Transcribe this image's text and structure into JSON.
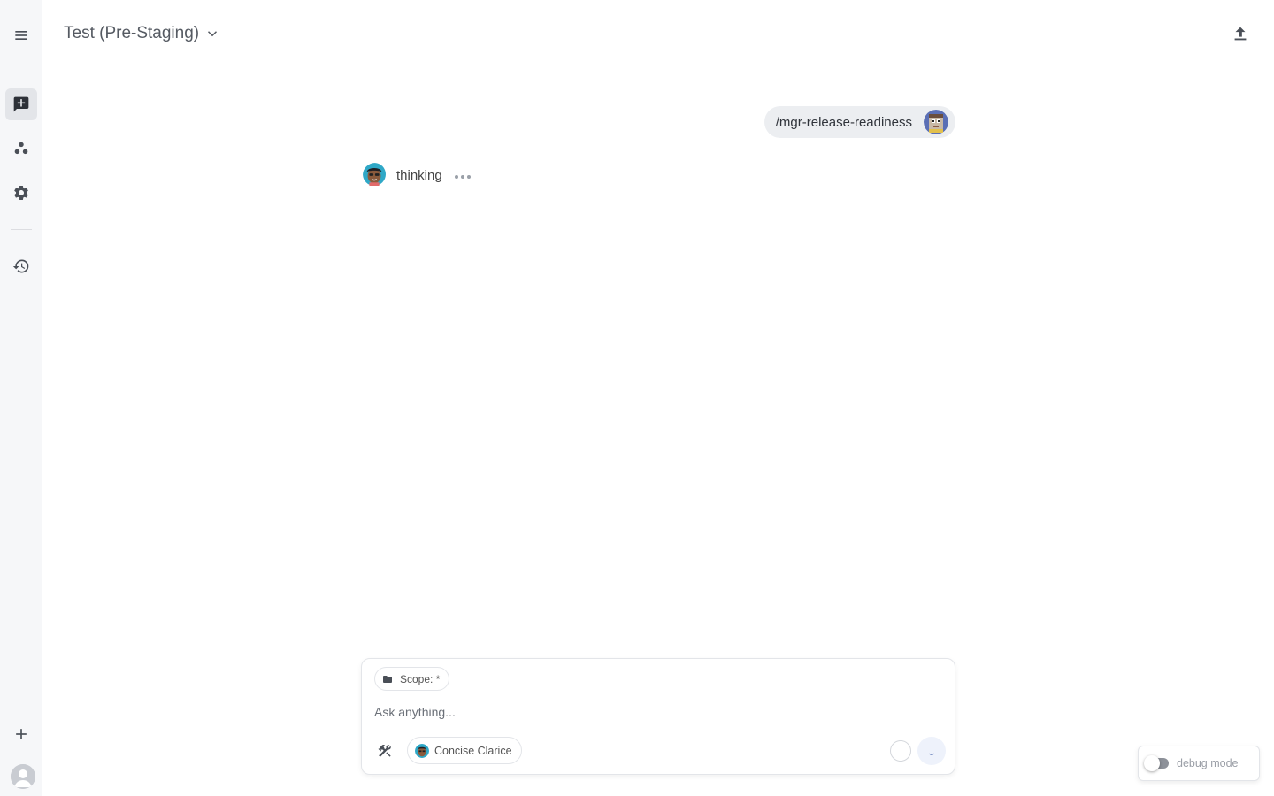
{
  "sidebar": {
    "items": [
      {
        "name": "menu-icon"
      },
      {
        "name": "new-chat-icon"
      },
      {
        "name": "agents-icon"
      },
      {
        "name": "settings-icon"
      },
      {
        "name": "history-icon"
      },
      {
        "name": "add-icon"
      },
      {
        "name": "user-avatar-icon"
      }
    ],
    "active": "new-chat-icon"
  },
  "header": {
    "title": "Test (Pre-Staging)",
    "dropdown_icon": "chevron-down-icon",
    "export_icon": "upload-icon"
  },
  "conversation": {
    "user_message": "/mgr-release-readiness",
    "assistant_status": "thinking"
  },
  "composer": {
    "scope_label": "Scope: *",
    "placeholder": "Ask anything...",
    "persona_name": "Concise Clarice"
  },
  "debug": {
    "label": "debug mode",
    "enabled": false
  },
  "colors": {
    "sidebar_bg": "#f6f7f9",
    "bubble_bg": "#eceef1",
    "send_bg": "#eef2fb"
  }
}
